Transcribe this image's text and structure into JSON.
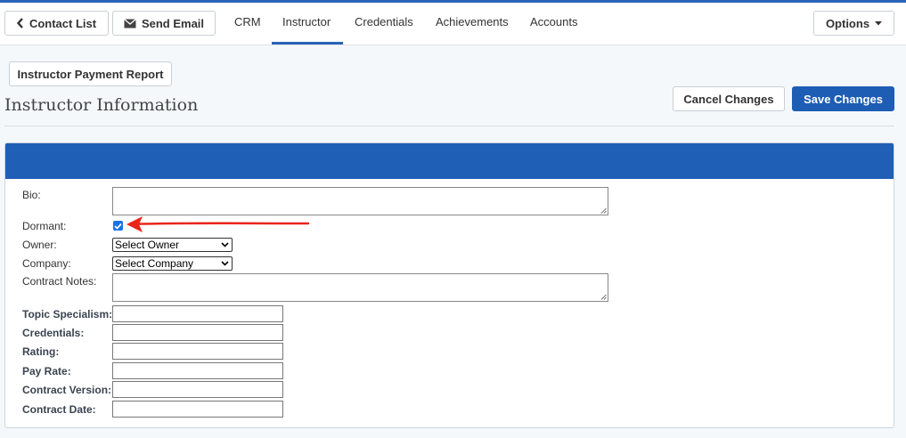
{
  "toolbar": {
    "contact_list": "Contact List",
    "send_email": "Send Email",
    "options": "Options"
  },
  "tabs": [
    "CRM",
    "Instructor",
    "Credentials",
    "Achievements",
    "Accounts"
  ],
  "active_tab": "Instructor",
  "report_button": "Instructor Payment Report",
  "page_title": "Instructor Information",
  "actions": {
    "cancel": "Cancel Changes",
    "save": "Save Changes"
  },
  "form": {
    "bio_label": "Bio:",
    "dormant_label": "Dormant:",
    "dormant_checked": true,
    "owner_label": "Owner:",
    "owner_value": "Select Owner",
    "company_label": "Company:",
    "company_value": "Select Company",
    "contract_notes_label": "Contract Notes:",
    "topic_label": "Topic Specialism:",
    "credentials_label": "Credentials:",
    "rating_label": "Rating:",
    "pay_rate_label": "Pay Rate:",
    "contract_version_label": "Contract Version:",
    "contract_date_label": "Contract Date:"
  },
  "colors": {
    "accent": "#2a64b8",
    "panel_header": "#1f5fb6",
    "annotation": "#e8261a"
  },
  "icons": [
    "chevron-left-icon",
    "envelope-icon",
    "caret-down-icon",
    "checkbox-check-icon",
    "red-arrow-annotation"
  ]
}
